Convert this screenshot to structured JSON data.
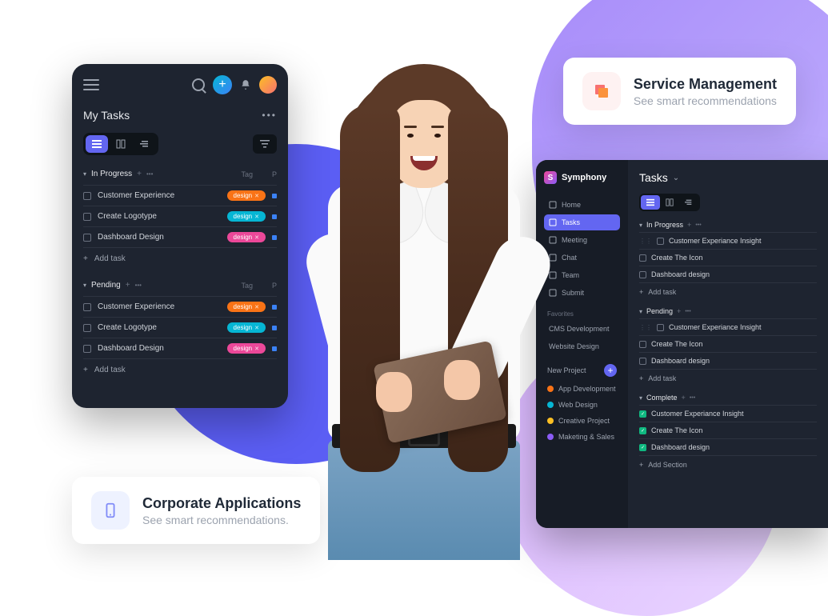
{
  "promo1": {
    "title": "Service Management",
    "sub": "See smart recommendations"
  },
  "promo2": {
    "title": "Corporate Applications",
    "sub": "See smart recommendations."
  },
  "mobile": {
    "title": "My Tasks",
    "sections": [
      {
        "name": "In Progress",
        "addLabel": "Add task",
        "tagHdr": "Tag",
        "tasks": [
          {
            "name": "Customer Experience",
            "tag": "design",
            "tagColor": "orange"
          },
          {
            "name": "Create Logotype",
            "tag": "design",
            "tagColor": "cyan"
          },
          {
            "name": "Dashboard Design",
            "tag": "design",
            "tagColor": "pink"
          }
        ]
      },
      {
        "name": "Pending",
        "addLabel": "Add task",
        "tagHdr": "Tag",
        "tasks": [
          {
            "name": "Customer Experience",
            "tag": "design",
            "tagColor": "orange"
          },
          {
            "name": "Create Logotype",
            "tag": "design",
            "tagColor": "cyan"
          },
          {
            "name": "Dashboard Design",
            "tag": "design",
            "tagColor": "pink"
          }
        ]
      }
    ]
  },
  "desktop": {
    "brand": "Symphony",
    "title": "Tasks",
    "nav": [
      {
        "label": "Home"
      },
      {
        "label": "Tasks",
        "active": true
      },
      {
        "label": "Meeting"
      },
      {
        "label": "Chat"
      },
      {
        "label": "Team"
      },
      {
        "label": "Submit"
      }
    ],
    "favSection": "Favorites",
    "favorites": [
      {
        "label": "CMS Development"
      },
      {
        "label": "Website Design"
      }
    ],
    "newProject": "New Project",
    "projects": [
      {
        "label": "App Development",
        "color": "#f97316"
      },
      {
        "label": "Web Design",
        "color": "#06b6d4"
      },
      {
        "label": "Creative Project",
        "color": "#fbbf24"
      },
      {
        "label": "Maketing & Sales",
        "color": "#8b5cf6"
      }
    ],
    "sections": [
      {
        "name": "In Progress",
        "add": "Add task",
        "tasks": [
          {
            "name": "Customer Experiance Insight"
          },
          {
            "name": "Create The Icon"
          },
          {
            "name": "Dashboard design"
          }
        ]
      },
      {
        "name": "Pending",
        "add": "Add task",
        "tasks": [
          {
            "name": "Customer Experiance Insight"
          },
          {
            "name": "Create The Icon"
          },
          {
            "name": "Dashboard design"
          }
        ]
      },
      {
        "name": "Complete",
        "add": "Add Section",
        "done": true,
        "tasks": [
          {
            "name": "Customer Experiance Insight"
          },
          {
            "name": "Create The Icon"
          },
          {
            "name": "Dashboard design"
          }
        ]
      }
    ]
  }
}
